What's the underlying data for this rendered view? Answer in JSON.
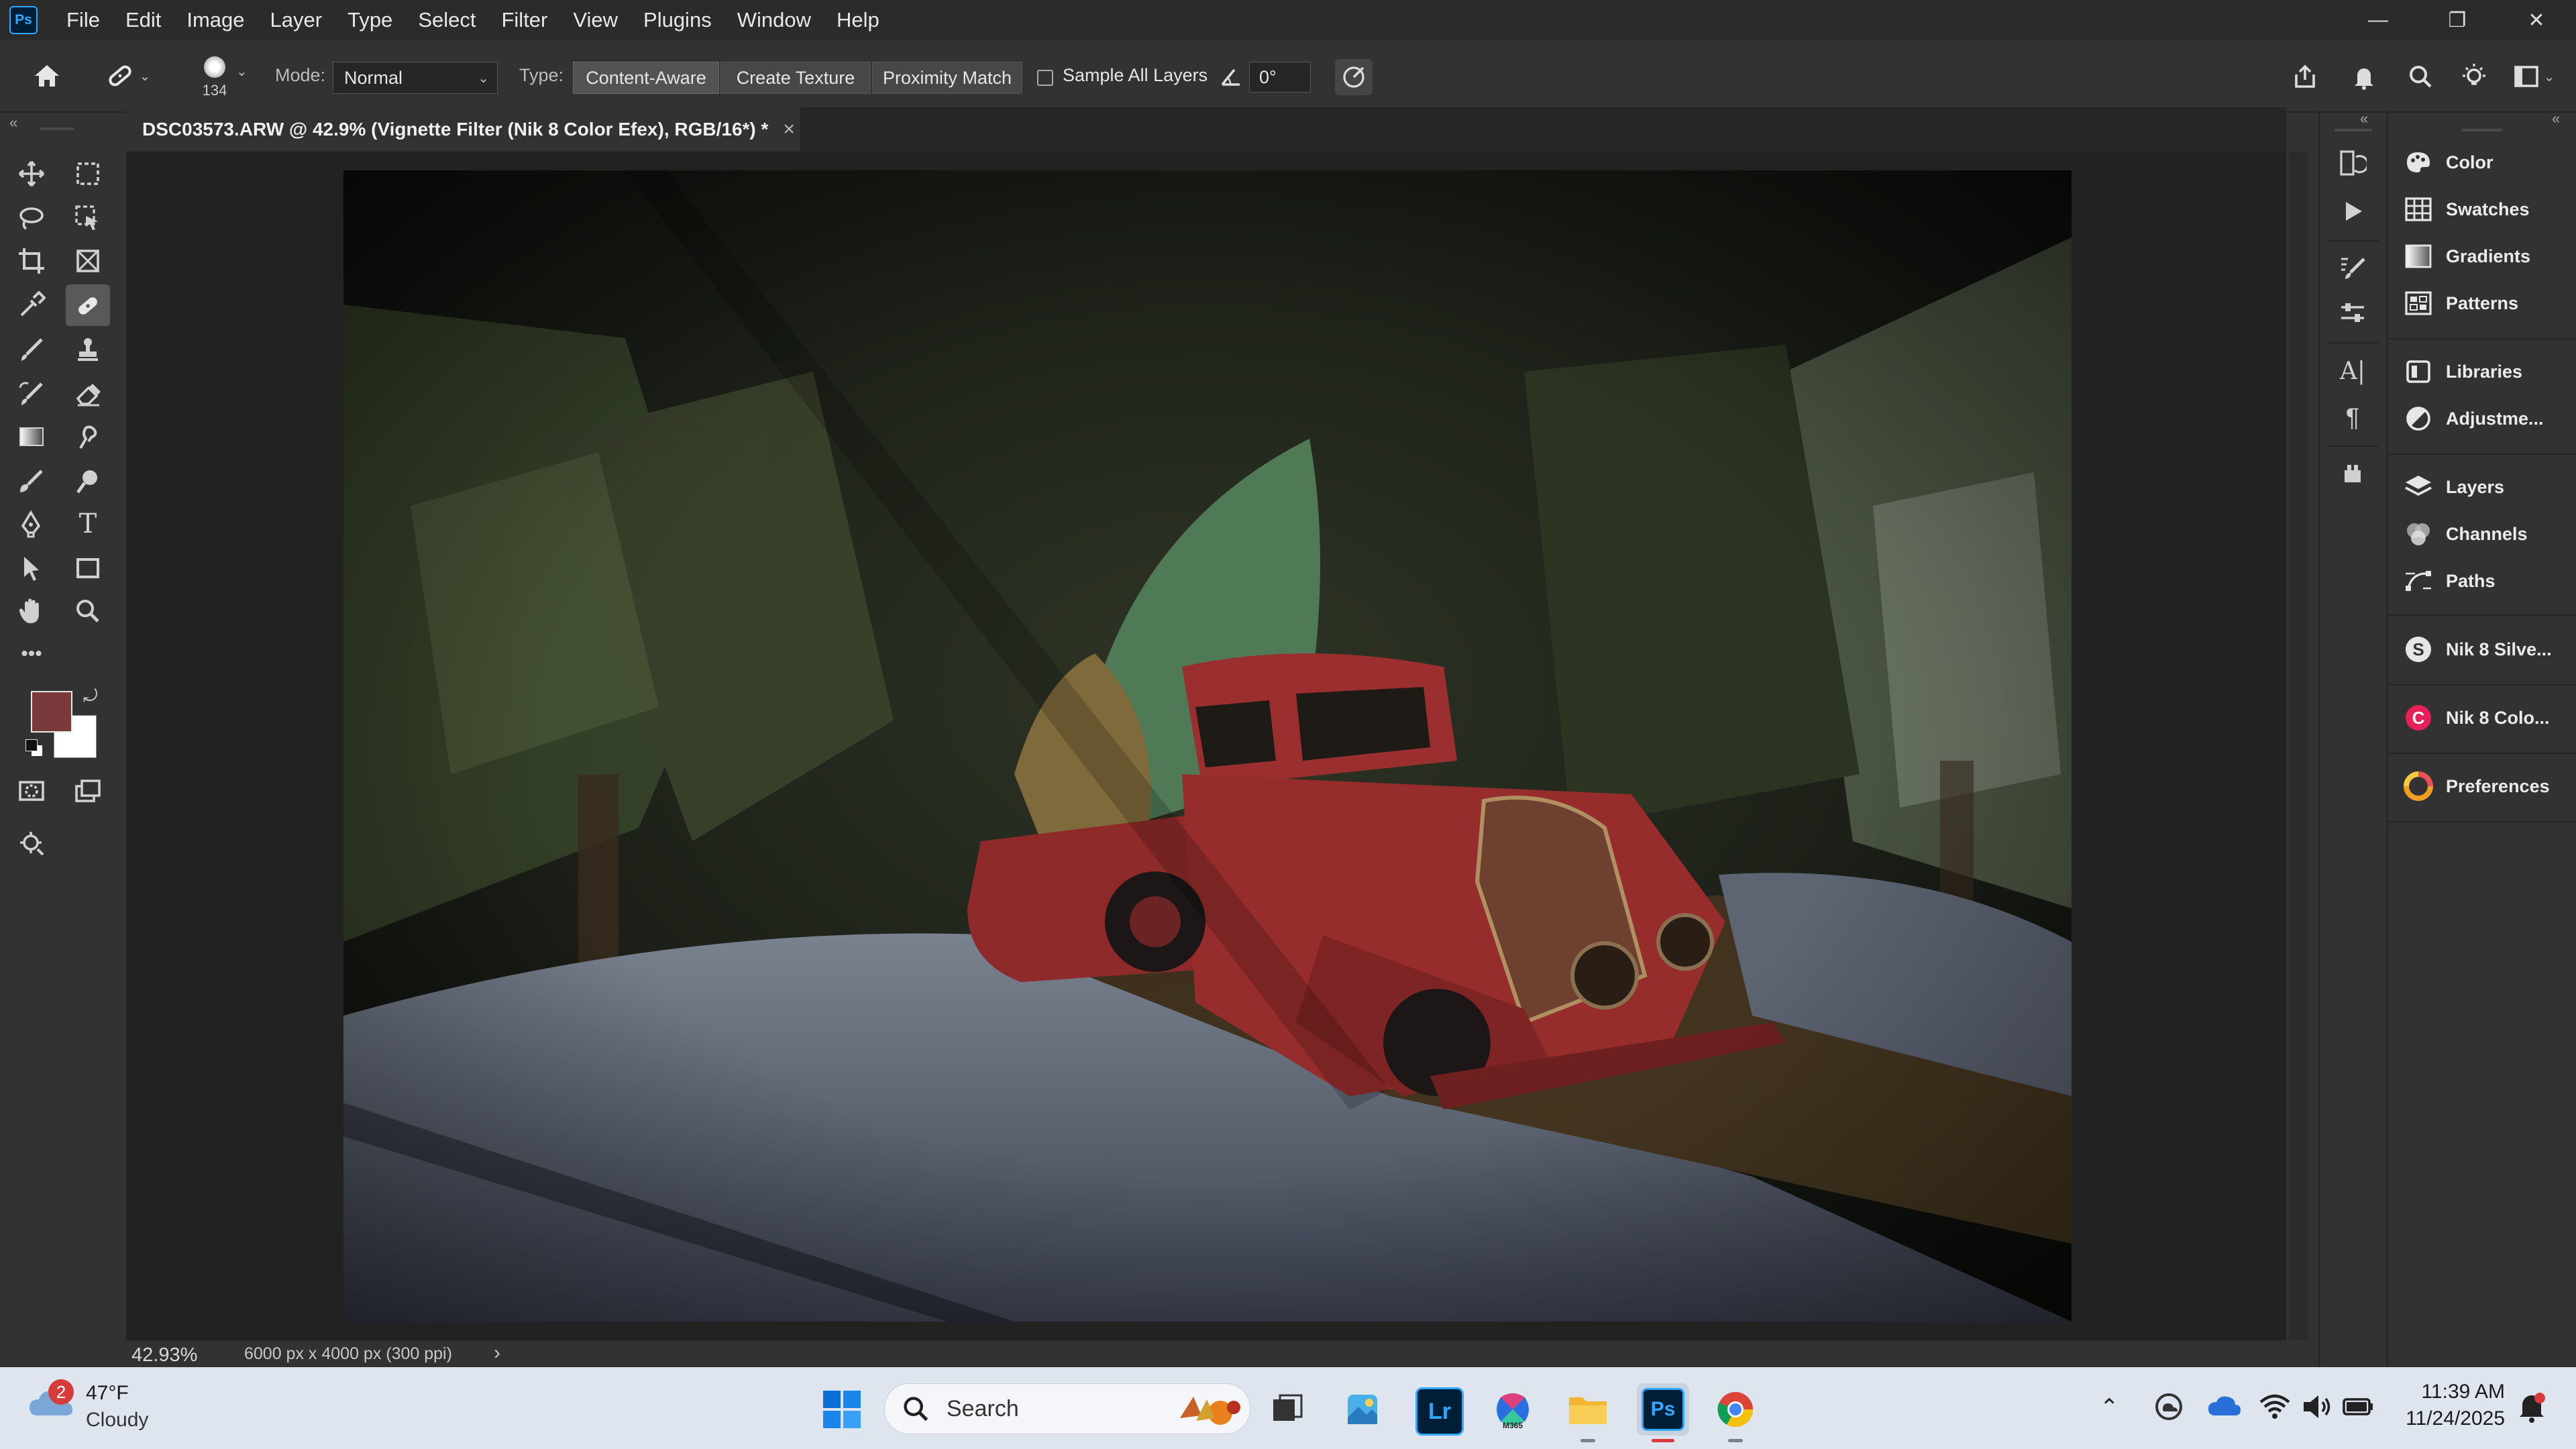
{
  "app": {
    "logo_text": "Ps",
    "menu": [
      "File",
      "Edit",
      "Image",
      "Layer",
      "Type",
      "Select",
      "Filter",
      "View",
      "Plugins",
      "Window",
      "Help"
    ],
    "window_controls": {
      "minimize": "—",
      "restore": "❐",
      "close": "✕"
    }
  },
  "options_bar": {
    "brush_size": "134",
    "mode_label": "Mode:",
    "mode_value": "Normal",
    "type_label": "Type:",
    "type_buttons": [
      "Content-Aware",
      "Create Texture",
      "Proximity Match"
    ],
    "type_selected": "Content-Aware",
    "sample_all_layers_label": "Sample All Layers",
    "sample_all_layers_checked": false,
    "angle_value": "0°"
  },
  "document": {
    "tab_title": "DSC03573.ARW @ 42.9% (Vignette Filter (Nik 8 Color Efex), RGB/16*) *",
    "close_glyph": "×"
  },
  "status_bar": {
    "zoom": "42.93%",
    "doc_info": "6000 px x 4000 px (300 ppi)",
    "arrow": "›"
  },
  "colors": {
    "foreground": "#7a3a3c",
    "background": "#ffffff",
    "accent": "#31a8ff"
  },
  "tools": [
    "move",
    "marquee",
    "lasso",
    "object-select",
    "crop",
    "frame",
    "eyedropper",
    "healing-brush",
    "brush",
    "stamp",
    "history-brush",
    "eraser",
    "gradient",
    "smudge",
    "brush-alt",
    "dodge",
    "pen",
    "type",
    "path-select",
    "rectangle",
    "hand",
    "zoom",
    "more",
    "quick-mask",
    "screen-mode",
    "generative"
  ],
  "panels": [
    {
      "name": "Color",
      "icon": "color-icon"
    },
    {
      "name": "Swatches",
      "icon": "swatches-icon"
    },
    {
      "name": "Gradients",
      "icon": "gradients-icon"
    },
    {
      "name": "Patterns",
      "icon": "patterns-icon"
    },
    {
      "name": "Libraries",
      "icon": "libraries-icon"
    },
    {
      "name": "Adjustme...",
      "icon": "adjustments-icon"
    },
    {
      "name": "Layers",
      "icon": "layers-icon"
    },
    {
      "name": "Channels",
      "icon": "channels-icon"
    },
    {
      "name": "Paths",
      "icon": "paths-icon"
    },
    {
      "name": "Nik 8 Silve...",
      "icon": "nik-silver-icon"
    },
    {
      "name": "Nik 8 Colo...",
      "icon": "nik-color-icon"
    },
    {
      "name": "Preferences",
      "icon": "preferences-icon"
    }
  ],
  "taskbar": {
    "weather_temp": "47°F",
    "weather_desc": "Cloudy",
    "weather_badge": "2",
    "search_placeholder": "Search",
    "time": "11:39 AM",
    "date": "11/24/2025",
    "pinned": [
      "task-view",
      "photos",
      "Lr",
      "M365",
      "file-explorer",
      "Ps",
      "chrome"
    ],
    "lr_label": "Lr",
    "ps_label": "Ps",
    "m365_label": "M365"
  }
}
